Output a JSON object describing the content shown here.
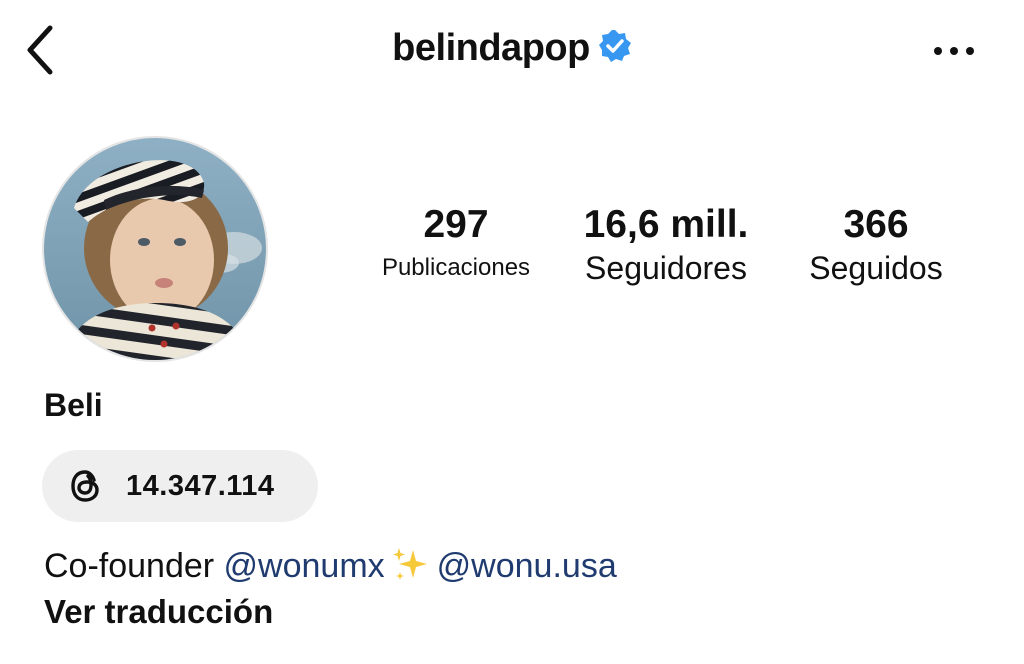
{
  "header": {
    "username": "belindapop",
    "back_icon": "chevron-left-icon",
    "verified_icon": "verified-badge-icon",
    "more_icon": "more-horizontal-icon"
  },
  "profile": {
    "display_name": "Beli",
    "avatar": "child-in-striped-beret-photo"
  },
  "stats": {
    "posts": {
      "value": "297",
      "label": "Publicaciones"
    },
    "followers": {
      "value": "16,6 mill.",
      "label": "Seguidores"
    },
    "following": {
      "value": "366",
      "label": "Seguidos"
    }
  },
  "threads": {
    "icon": "threads-icon",
    "count": "14.347.114"
  },
  "bio": {
    "prefix": "Co-founder ",
    "mention_1": "@wonumx",
    "emoji": "sparkles-icon",
    "mention_2": "@wonu.usa",
    "translate_label": "Ver traducción"
  },
  "colors": {
    "verified_blue": "#3897f0",
    "mention_blue": "#1f3b6f",
    "pill_bg": "#efefef"
  }
}
